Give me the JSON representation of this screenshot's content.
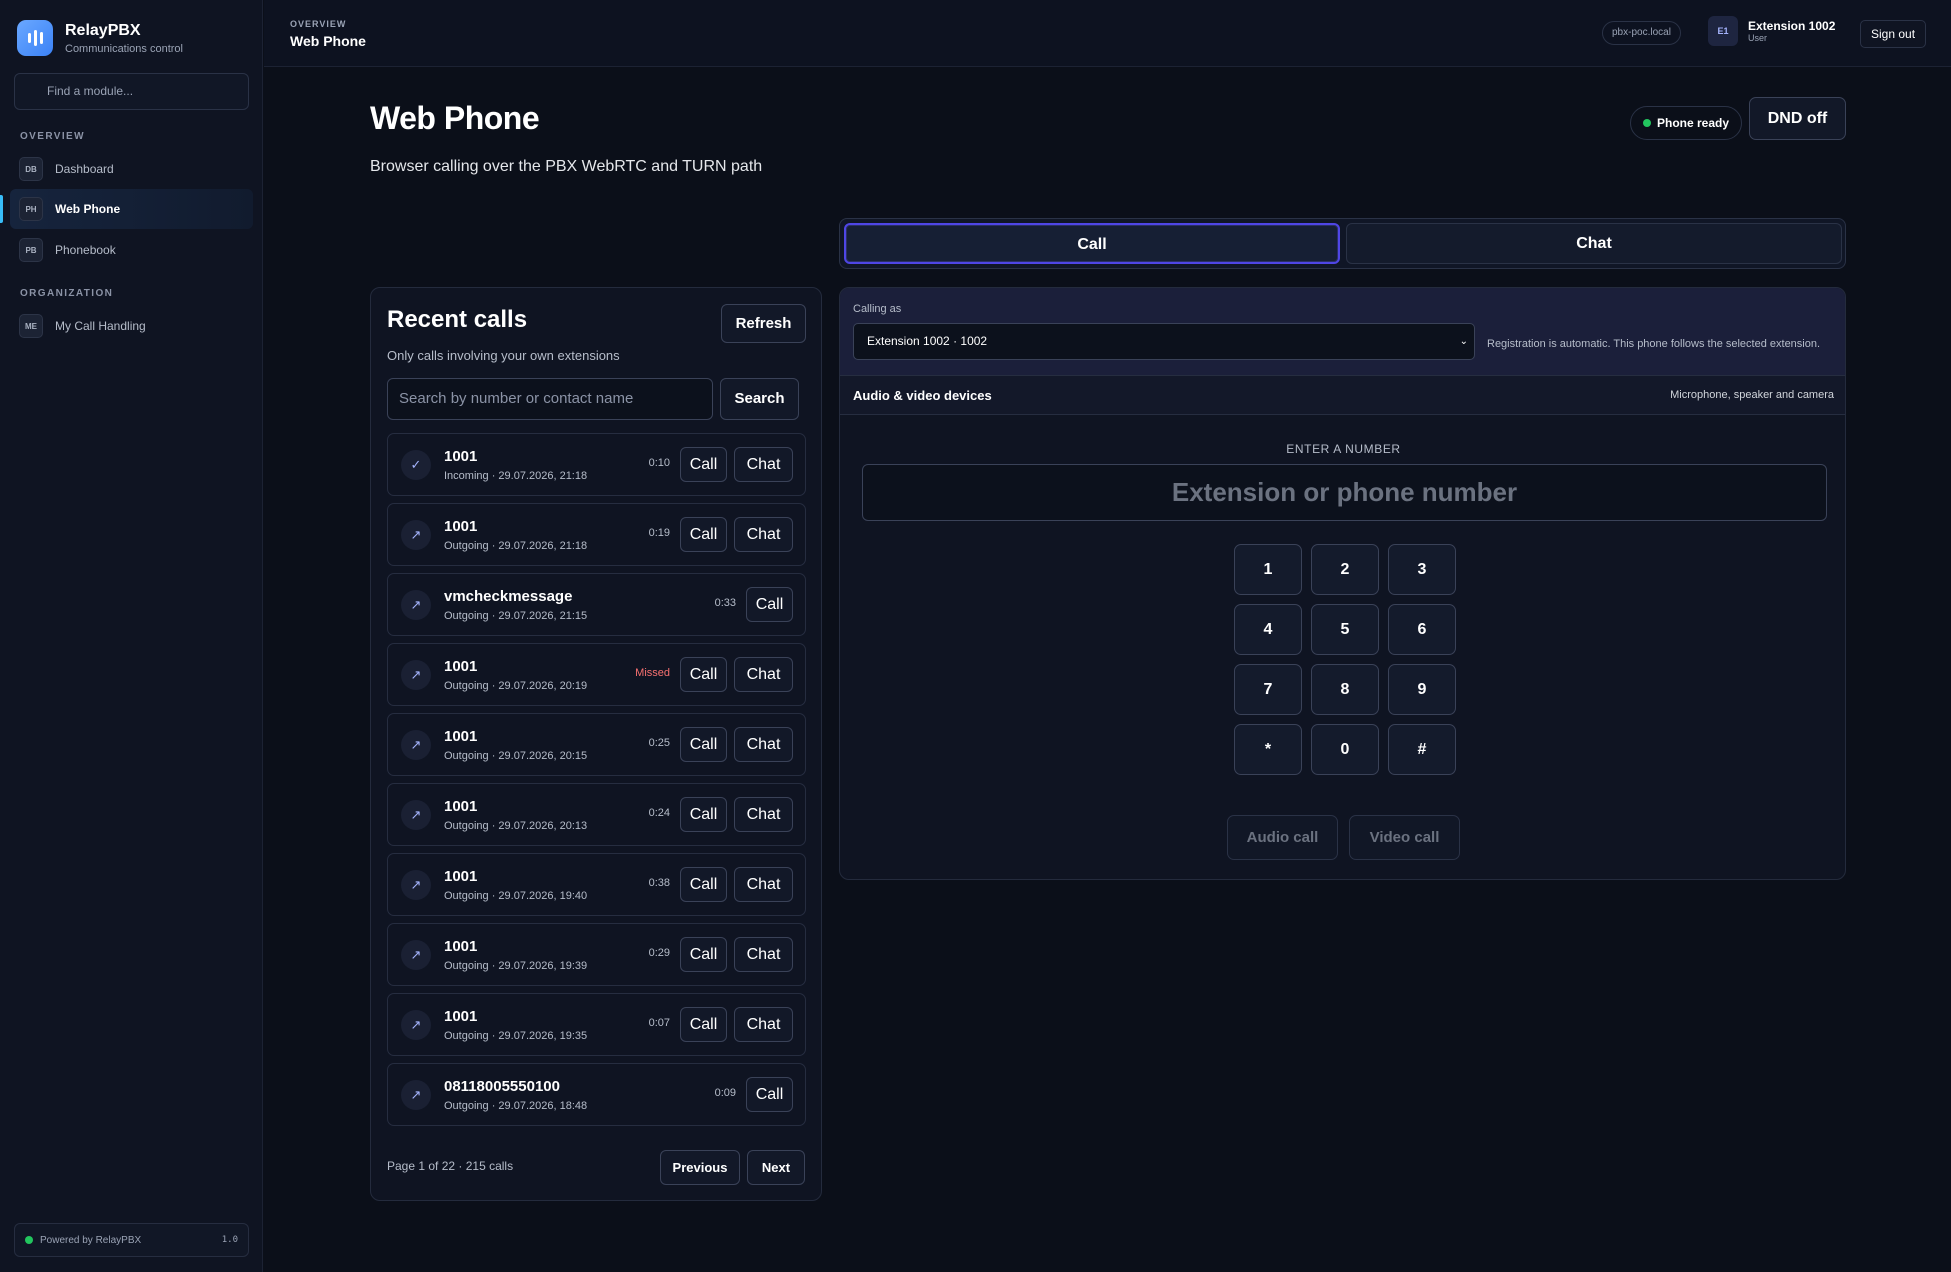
{
  "brand": {
    "name": "RelayPBX",
    "subtitle": "Communications control"
  },
  "sidebar": {
    "search_placeholder": "Find a module...",
    "sections": [
      {
        "label": "OVERVIEW"
      },
      {
        "label": "ORGANIZATION"
      }
    ],
    "items": [
      {
        "badge": "DB",
        "label": "Dashboard",
        "active": false
      },
      {
        "badge": "PH",
        "label": "Web Phone",
        "active": true
      },
      {
        "badge": "PB",
        "label": "Phonebook",
        "active": false
      },
      {
        "badge": "ME",
        "label": "My Call Handling",
        "active": false
      }
    ],
    "footer": {
      "text": "Powered by RelayPBX",
      "version": "1.0",
      "status_color": "#22c55e"
    }
  },
  "topbar": {
    "eyebrow": "OVERVIEW",
    "title": "Web Phone",
    "host": "pbx-poc.local",
    "user": {
      "avatar": "E1",
      "name": "Extension 1002",
      "role": "User"
    },
    "signout": "Sign out"
  },
  "header": {
    "title": "Web Phone",
    "subtitle": "Browser calling over the PBX WebRTC and TURN path",
    "status": "Phone ready",
    "dnd": "DND off"
  },
  "tabs": [
    {
      "label": "Call",
      "active": true
    },
    {
      "label": "Chat",
      "active": false
    }
  ],
  "recent": {
    "title": "Recent calls",
    "subtitle": "Only calls involving your own extensions",
    "refresh": "Refresh",
    "search_placeholder": "Search by number or contact name",
    "search_button": "Search",
    "call_label": "Call",
    "chat_label": "Chat",
    "rows": [
      {
        "name": "1001",
        "meta": "Incoming · 29.07.2026, 21:18",
        "duration": "0:10",
        "icon": "✓",
        "missed": false,
        "chat": true
      },
      {
        "name": "1001",
        "meta": "Outgoing · 29.07.2026, 21:18",
        "duration": "0:19",
        "icon": "↗",
        "missed": false,
        "chat": true
      },
      {
        "name": "vmcheckmessage",
        "meta": "Outgoing · 29.07.2026, 21:15",
        "duration": "0:33",
        "icon": "↗",
        "missed": false,
        "chat": false
      },
      {
        "name": "1001",
        "meta": "Outgoing · 29.07.2026, 20:19",
        "duration": "Missed",
        "icon": "↗",
        "missed": true,
        "chat": true
      },
      {
        "name": "1001",
        "meta": "Outgoing · 29.07.2026, 20:15",
        "duration": "0:25",
        "icon": "↗",
        "missed": false,
        "chat": true
      },
      {
        "name": "1001",
        "meta": "Outgoing · 29.07.2026, 20:13",
        "duration": "0:24",
        "icon": "↗",
        "missed": false,
        "chat": true
      },
      {
        "name": "1001",
        "meta": "Outgoing · 29.07.2026, 19:40",
        "duration": "0:38",
        "icon": "↗",
        "missed": false,
        "chat": true
      },
      {
        "name": "1001",
        "meta": "Outgoing · 29.07.2026, 19:39",
        "duration": "0:29",
        "icon": "↗",
        "missed": false,
        "chat": true
      },
      {
        "name": "1001",
        "meta": "Outgoing · 29.07.2026, 19:35",
        "duration": "0:07",
        "icon": "↗",
        "missed": false,
        "chat": true
      },
      {
        "name": "08118005550100",
        "meta": "Outgoing · 29.07.2026, 18:48",
        "duration": "0:09",
        "icon": "↗",
        "missed": false,
        "chat": false
      }
    ],
    "pager": {
      "text": "Page 1 of 22 · 215 calls",
      "previous": "Previous",
      "next": "Next"
    }
  },
  "dialer": {
    "calling_as_label": "Calling as",
    "extension": "Extension 1002 · 1002",
    "registration_note": "Registration is automatic. This phone follows the selected extension.",
    "devices_title": "Audio & video devices",
    "devices_sub": "Microphone, speaker and camera",
    "enter_label": "ENTER A NUMBER",
    "number_placeholder": "Extension or phone number",
    "keys": [
      "1",
      "2",
      "3",
      "4",
      "5",
      "6",
      "7",
      "8",
      "9",
      "*",
      "0",
      "#"
    ],
    "audio_call": "Audio call",
    "video_call": "Video call"
  },
  "colors": {
    "accent": "#4f46e5",
    "ready": "#22c55e",
    "missed": "#f87171"
  }
}
